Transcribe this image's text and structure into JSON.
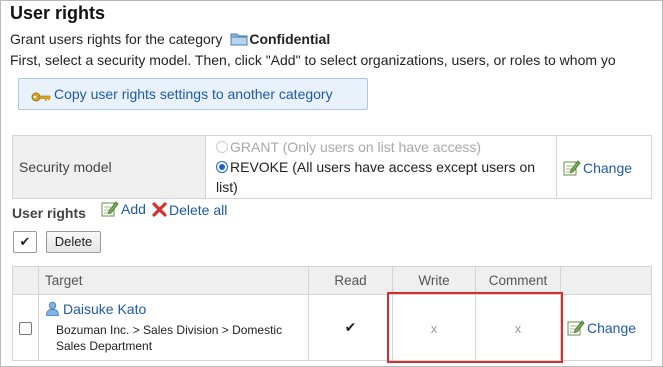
{
  "page": {
    "title": "User rights",
    "grant_prefix": "Grant users rights for the category",
    "category_name": "Confidential",
    "instructions": "First, select a security model. Then, click \"Add\" to select organizations, users, or roles to whom yo"
  },
  "copy_button": {
    "label": "Copy user rights settings to another category"
  },
  "security_model": {
    "label": "Security model",
    "option_grant": "GRANT (Only users on list have access)",
    "option_revoke": "REVOKE (All users have access except users on list)",
    "selected": "REVOKE",
    "change_label": "Change"
  },
  "user_rights": {
    "heading": "User rights",
    "add_label": "Add",
    "delete_all_label": "Delete all",
    "select_all_glyph": "✔",
    "delete_button": "Delete",
    "columns": {
      "target": "Target",
      "read": "Read",
      "write": "Write",
      "comment": "Comment"
    },
    "rows": [
      {
        "name": "Daisuke Kato",
        "org": "Bozuman Inc. > Sales Division > Domestic Sales Department",
        "read": "✔",
        "write": "x",
        "comment": "x",
        "change_label": "Change"
      }
    ]
  },
  "colors": {
    "link": "#1c5aa8",
    "highlight": "#d32f2f",
    "header_bg": "#efefef",
    "button_bg": "#e9f2fb"
  }
}
